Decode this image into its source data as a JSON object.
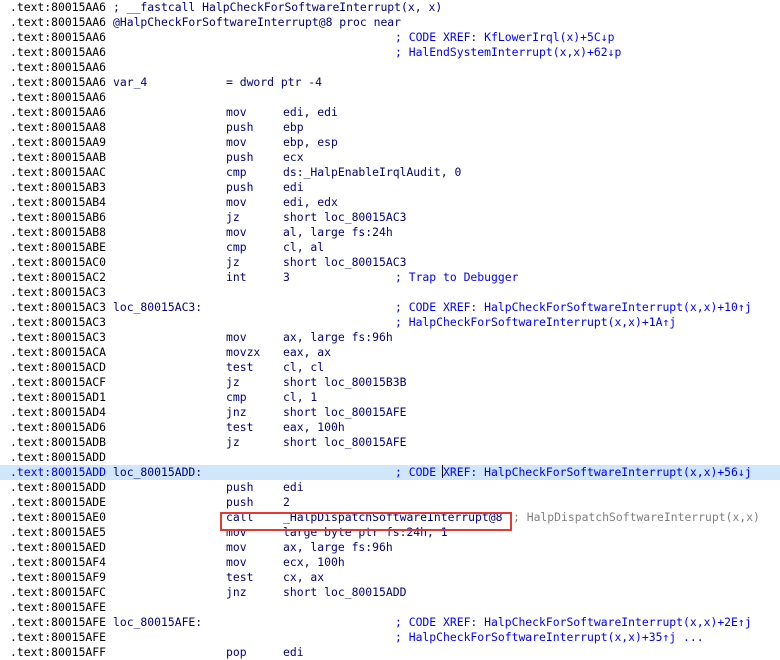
{
  "rows": [
    {
      "addr": ".text:80015AA6",
      "lead": "; __fastcall HalpCheckForSoftwareInterrupt(x, x)"
    },
    {
      "addr": ".text:80015AA6",
      "lead": "@HalpCheckForSoftwareInterrupt@8 proc near"
    },
    {
      "addr": ".text:80015AA6",
      "comment": "; CODE XREF: KfLowerIrql(x)+5C↓p"
    },
    {
      "addr": ".text:80015AA6",
      "comment": "; HalEndSystemInterrupt(x,x)+62↓p"
    },
    {
      "addr": ".text:80015AA6"
    },
    {
      "addr": ".text:80015AA6",
      "label": "var_4",
      "mnem": "= dword ptr -4"
    },
    {
      "addr": ".text:80015AA6"
    },
    {
      "addr": ".text:80015AA6",
      "mnem": "mov",
      "ops": "edi, edi"
    },
    {
      "addr": ".text:80015AA8",
      "mnem": "push",
      "ops": "ebp"
    },
    {
      "addr": ".text:80015AA9",
      "mnem": "mov",
      "ops": "ebp, esp"
    },
    {
      "addr": ".text:80015AAB",
      "mnem": "push",
      "ops": "ecx"
    },
    {
      "addr": ".text:80015AAC",
      "mnem": "cmp",
      "ops": "ds:_HalpEnableIrqlAudit, 0"
    },
    {
      "addr": ".text:80015AB3",
      "mnem": "push",
      "ops": "edi"
    },
    {
      "addr": ".text:80015AB4",
      "mnem": "mov",
      "ops": "edi, edx"
    },
    {
      "addr": ".text:80015AB6",
      "mnem": "jz",
      "ops": "short loc_80015AC3"
    },
    {
      "addr": ".text:80015AB8",
      "mnem": "mov",
      "ops": "al, large fs:24h"
    },
    {
      "addr": ".text:80015ABE",
      "mnem": "cmp",
      "ops": "cl, al"
    },
    {
      "addr": ".text:80015AC0",
      "mnem": "jz",
      "ops": "short loc_80015AC3"
    },
    {
      "addr": ".text:80015AC2",
      "mnem": "int",
      "ops": "3",
      "comment": "; Trap to Debugger"
    },
    {
      "addr": ".text:80015AC3"
    },
    {
      "addr": ".text:80015AC3",
      "label": "loc_80015AC3:",
      "comment": "; CODE XREF: HalpCheckForSoftwareInterrupt(x,x)+10↑j"
    },
    {
      "addr": ".text:80015AC3",
      "comment": "; HalpCheckForSoftwareInterrupt(x,x)+1A↑j"
    },
    {
      "addr": ".text:80015AC3",
      "mnem": "mov",
      "ops": "ax, large fs:96h"
    },
    {
      "addr": ".text:80015ACA",
      "mnem": "movzx",
      "ops": "eax, ax"
    },
    {
      "addr": ".text:80015ACD",
      "mnem": "test",
      "ops": "cl, cl"
    },
    {
      "addr": ".text:80015ACF",
      "mnem": "jz",
      "ops": "short loc_80015B3B"
    },
    {
      "addr": ".text:80015AD1",
      "mnem": "cmp",
      "ops": "cl, 1"
    },
    {
      "addr": ".text:80015AD4",
      "mnem": "jnz",
      "ops": "short loc_80015AFE"
    },
    {
      "addr": ".text:80015AD6",
      "mnem": "test",
      "ops": "eax, 100h"
    },
    {
      "addr": ".text:80015ADB",
      "mnem": "jz",
      "ops": "short loc_80015AFE"
    },
    {
      "addr": ".text:80015ADD"
    },
    {
      "addr": ".text:80015ADD",
      "label": "loc_80015ADD:",
      "comment": "; CODE XREF: HalpCheckForSoftwareInterrupt(x,x)+56↓j",
      "highlight": true
    },
    {
      "addr": ".text:80015ADD",
      "mnem": "push",
      "ops": "edi"
    },
    {
      "addr": ".text:80015ADE",
      "mnem": "push",
      "ops": "2"
    },
    {
      "addr": ".text:80015AE0",
      "mnem": "call",
      "ops": "_HalpDispatchSoftwareInterrupt@8",
      "after": "; HalpDispatchSoftwareInterrupt(x,x)"
    },
    {
      "addr": ".text:80015AE5",
      "mnem": "mov",
      "ops": "large byte ptr fs:24h, 1"
    },
    {
      "addr": ".text:80015AED",
      "mnem": "mov",
      "ops": "ax, large fs:96h"
    },
    {
      "addr": ".text:80015AF4",
      "mnem": "mov",
      "ops": "ecx, 100h"
    },
    {
      "addr": ".text:80015AF9",
      "mnem": "test",
      "ops": "cx, ax"
    },
    {
      "addr": ".text:80015AFC",
      "mnem": "jnz",
      "ops": "short loc_80015ADD"
    },
    {
      "addr": ".text:80015AFE"
    },
    {
      "addr": ".text:80015AFE",
      "label": "loc_80015AFE:",
      "comment": "; CODE XREF: HalpCheckForSoftwareInterrupt(x,x)+2E↑j"
    },
    {
      "addr": ".text:80015AFE",
      "comment": "; HalpCheckForSoftwareInterrupt(x,x)+35↑j ..."
    },
    {
      "addr": ".text:80015AFF",
      "mnem": "pop",
      "ops": "edi"
    }
  ]
}
